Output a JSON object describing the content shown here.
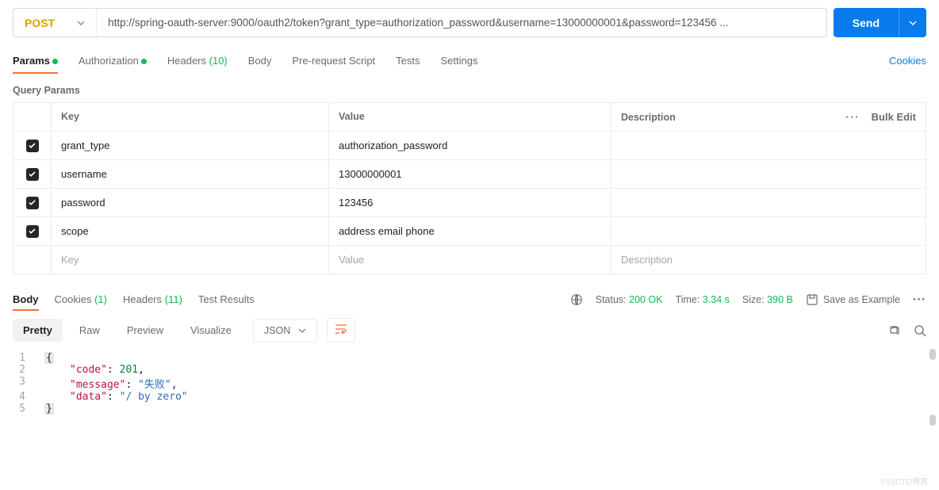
{
  "request": {
    "method": "POST",
    "url": "http://spring-oauth-server:9000/oauth2/token?grant_type=authorization_password&username=13000000001&password=123456 ...",
    "send_label": "Send"
  },
  "tabs": {
    "params": "Params",
    "authorization": "Authorization",
    "headers": "Headers",
    "headers_count": "(10)",
    "body": "Body",
    "prerequest": "Pre-request Script",
    "tests": "Tests",
    "settings": "Settings",
    "cookies": "Cookies"
  },
  "section": {
    "query_params": "Query Params"
  },
  "table": {
    "headers": {
      "key": "Key",
      "value": "Value",
      "description": "Description",
      "bulk_edit": "Bulk Edit"
    },
    "rows": [
      {
        "key": "grant_type",
        "value": "authorization_password"
      },
      {
        "key": "username",
        "value": "13000000001"
      },
      {
        "key": "password",
        "value": "123456"
      },
      {
        "key": "scope",
        "value": "address email phone"
      }
    ],
    "placeholder": {
      "key": "Key",
      "value": "Value",
      "description": "Description"
    }
  },
  "response": {
    "tabs": {
      "body": "Body",
      "cookies": "Cookies",
      "cookies_count": "(1)",
      "headers": "Headers",
      "headers_count": "(11)",
      "test_results": "Test Results"
    },
    "status_label": "Status:",
    "status_value": "200 OK",
    "time_label": "Time:",
    "time_value": "3.34 s",
    "size_label": "Size:",
    "size_value": "390 B",
    "save_example": "Save as Example"
  },
  "view": {
    "pretty": "Pretty",
    "raw": "Raw",
    "preview": "Preview",
    "visualize": "Visualize",
    "format": "JSON"
  },
  "body": {
    "lines": [
      "1",
      "2",
      "3",
      "4",
      "5"
    ],
    "code_key": "\"code\"",
    "code_val": "201",
    "msg_key": "\"message\"",
    "msg_val": "\"失败\"",
    "data_key": "\"data\"",
    "data_val": "\"/ by zero\""
  },
  "watermark": "©51CTO博客"
}
